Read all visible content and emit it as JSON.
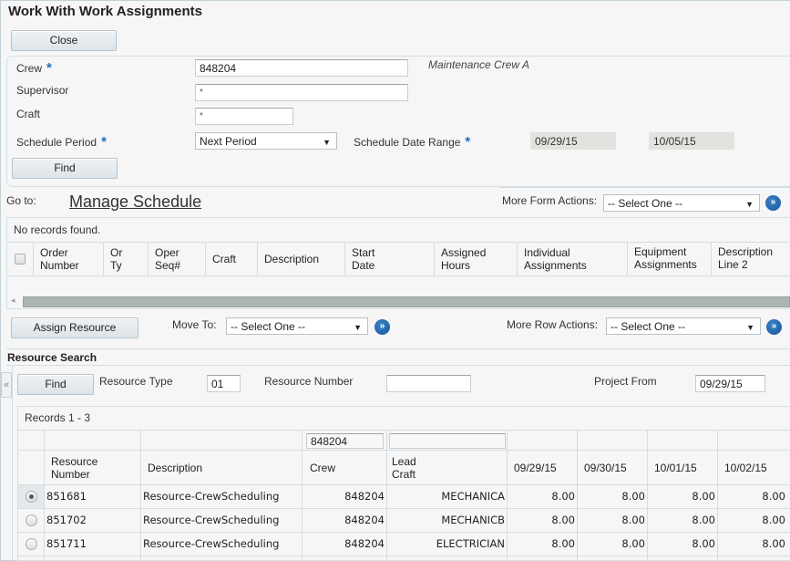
{
  "window": {
    "title": "Work With Work Assignments"
  },
  "toolbar": {
    "close_label": "Close"
  },
  "header_form": {
    "crew": {
      "label": "Crew",
      "value": "848204",
      "description": "Maintenance Crew A",
      "required": true
    },
    "supervisor": {
      "label": "Supervisor",
      "value": "*"
    },
    "craft": {
      "label": "Craft",
      "value": "*"
    },
    "schedule_period": {
      "label": "Schedule Period",
      "value": "Next Period",
      "required": true
    },
    "schedule_date_range": {
      "label": "Schedule Date Range",
      "from": "09/29/15",
      "to": "10/05/15",
      "required": true
    },
    "find_label": "Find",
    "required_marker": "*"
  },
  "goto": {
    "label": "Go to:",
    "link": "Manage Schedule"
  },
  "form_actions": {
    "label": "More Form Actions:",
    "value": "-- Select One --",
    "go_icon": "double-chevron-right-icon",
    "go_glyph": "»"
  },
  "orders_grid": {
    "status": "No records found.",
    "columns": [
      "Order\nNumber",
      "Or\nTy",
      "Oper\nSeq#",
      "Craft",
      "Description",
      "Start\nDate",
      "Assigned\nHours",
      "Individual\nAssignments",
      "Equipment\nAssignments",
      "Description\nLine 2"
    ],
    "col_order_number": [
      "Order",
      "Number"
    ],
    "col_or_ty": [
      "Or",
      "Ty"
    ],
    "col_oper_seq": [
      "Oper",
      "Seq#"
    ],
    "col_craft": "Craft",
    "col_description": "Description",
    "col_start_date": [
      "Start",
      "Date"
    ],
    "col_assigned_hours": [
      "Assigned",
      "Hours"
    ],
    "col_individual_assignments": [
      "Individual",
      "Assignments"
    ],
    "col_equipment_assignments": [
      "Equipment",
      "Assignments"
    ],
    "col_description_line2": [
      "Description",
      "Line 2"
    ],
    "scroll_left_glyph": "◂"
  },
  "row_actions": {
    "assign_resource_label": "Assign Resource",
    "move_to_label": "Move To:",
    "move_to_value": "-- Select One --",
    "more_row_actions_label": "More Row Actions:",
    "more_row_actions_value": "-- Select One --",
    "go_glyph": "»"
  },
  "resource_search": {
    "title": "Resource Search",
    "find_label": "Find",
    "resource_type_label": "Resource Type",
    "resource_type_value": "01",
    "resource_number_label": "Resource Number",
    "resource_number_value": "",
    "project_from_label": "Project From",
    "project_from_value": "09/29/15",
    "collapse_glyph": "«"
  },
  "resource_grid": {
    "records_label": "Records 1 - 3",
    "filters": {
      "crew": "848204",
      "lead_craft": ""
    },
    "col_resource_number": [
      "Resource",
      "Number"
    ],
    "col_description": "Description",
    "col_crew": "Crew",
    "col_lead_craft": [
      "Lead",
      "Craft"
    ],
    "date_columns": [
      "09/29/15",
      "09/30/15",
      "10/01/15",
      "10/02/15"
    ],
    "rows": [
      {
        "selected": true,
        "resource_number": "851681",
        "description": "Resource-CrewScheduling",
        "crew": "848204",
        "lead_craft": "MECHANICA",
        "hours": [
          "8.00",
          "8.00",
          "8.00",
          "8.00"
        ]
      },
      {
        "selected": false,
        "resource_number": "851702",
        "description": "Resource-CrewScheduling",
        "crew": "848204",
        "lead_craft": "MECHANICB",
        "hours": [
          "8.00",
          "8.00",
          "8.00",
          "8.00"
        ]
      },
      {
        "selected": false,
        "resource_number": "851711",
        "description": "Resource-CrewScheduling",
        "crew": "848204",
        "lead_craft": "ELECTRICIAN",
        "hours": [
          "8.00",
          "8.00",
          "8.00",
          "8.00"
        ]
      }
    ]
  }
}
